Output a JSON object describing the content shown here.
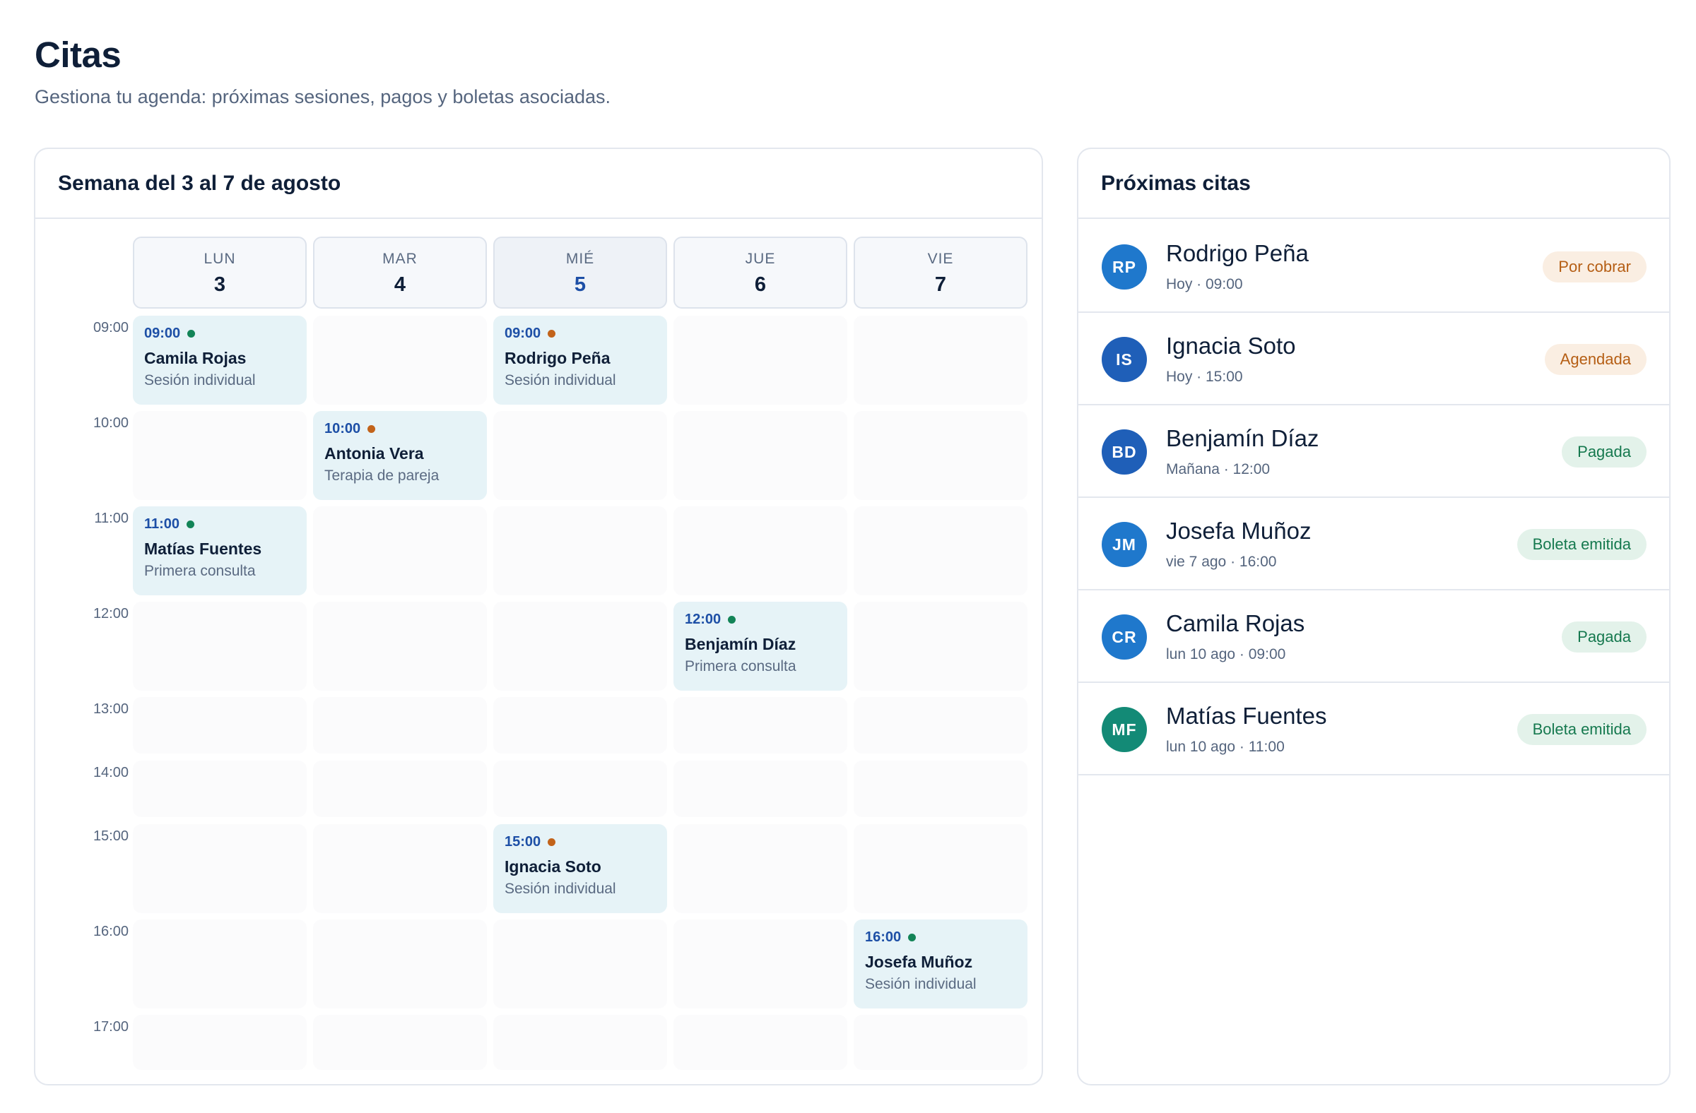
{
  "page": {
    "title": "Citas",
    "subtitle": "Gestiona tu agenda: próximas sesiones, pagos y boletas asociadas."
  },
  "calendar": {
    "title": "Semana del 3 al 7 de agosto",
    "days": [
      {
        "name": "LUN",
        "num": "3",
        "today": false
      },
      {
        "name": "MAR",
        "num": "4",
        "today": false
      },
      {
        "name": "MIÉ",
        "num": "5",
        "today": true
      },
      {
        "name": "JUE",
        "num": "6",
        "today": false
      },
      {
        "name": "VIE",
        "num": "7",
        "today": false
      }
    ],
    "hours": [
      "09:00",
      "10:00",
      "11:00",
      "12:00",
      "13:00",
      "14:00",
      "15:00",
      "16:00",
      "17:00"
    ],
    "events": [
      {
        "day": 0,
        "hour": "09:00",
        "time": "09:00",
        "status": "green",
        "name": "Camila Rojas",
        "type": "Sesión individual"
      },
      {
        "day": 2,
        "hour": "09:00",
        "time": "09:00",
        "status": "orange",
        "name": "Rodrigo Peña",
        "type": "Sesión individual"
      },
      {
        "day": 1,
        "hour": "10:00",
        "time": "10:00",
        "status": "orange",
        "name": "Antonia Vera",
        "type": "Terapia de pareja"
      },
      {
        "day": 0,
        "hour": "11:00",
        "time": "11:00",
        "status": "green",
        "name": "Matías Fuentes",
        "type": "Primera consulta"
      },
      {
        "day": 3,
        "hour": "12:00",
        "time": "12:00",
        "status": "green",
        "name": "Benjamín Díaz",
        "type": "Primera consulta"
      },
      {
        "day": 2,
        "hour": "15:00",
        "time": "15:00",
        "status": "orange",
        "name": "Ignacia Soto",
        "type": "Sesión individual"
      },
      {
        "day": 4,
        "hour": "16:00",
        "time": "16:00",
        "status": "green",
        "name": "Josefa Muñoz",
        "type": "Sesión individual"
      }
    ]
  },
  "upcoming": {
    "title": "Próximas citas",
    "items": [
      {
        "initials": "RP",
        "name": "Rodrigo Peña",
        "when": "Hoy · 09:00",
        "status": "Por cobrar",
        "kind": "warn",
        "color": "#1f78cc"
      },
      {
        "initials": "IS",
        "name": "Ignacia Soto",
        "when": "Hoy · 15:00",
        "status": "Agendada",
        "kind": "warn",
        "color": "#1f5fb8"
      },
      {
        "initials": "BD",
        "name": "Benjamín Díaz",
        "when": "Mañana · 12:00",
        "status": "Pagada",
        "kind": "ok",
        "color": "#1f5fb8"
      },
      {
        "initials": "JM",
        "name": "Josefa Muñoz",
        "when": "vie 7 ago · 16:00",
        "status": "Boleta emitida",
        "kind": "ok",
        "color": "#1f78cc"
      },
      {
        "initials": "CR",
        "name": "Camila Rojas",
        "when": "lun 10 ago · 09:00",
        "status": "Pagada",
        "kind": "ok",
        "color": "#1f78cc"
      },
      {
        "initials": "MF",
        "name": "Matías Fuentes",
        "when": "lun 10 ago · 11:00",
        "status": "Boleta emitida",
        "kind": "ok",
        "color": "#138a76"
      }
    ]
  }
}
